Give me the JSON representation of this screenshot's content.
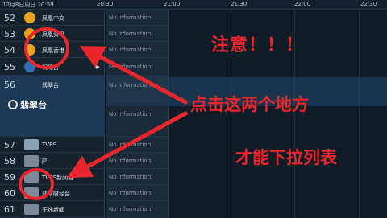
{
  "header": {
    "date": "12月8日周日 20:59",
    "ticks": [
      "20:30",
      "21:00",
      "21:30",
      "22:00",
      "22:30"
    ]
  },
  "channels": [
    {
      "num": "52",
      "name": "凤凰中文",
      "logo_color": "#e9a21c"
    },
    {
      "num": "53",
      "name": "凤凰资讯",
      "logo_color": "#e9a21c"
    },
    {
      "num": "54",
      "name": "凤凰香港",
      "logo_color": "#e9a21c"
    },
    {
      "num": "55",
      "name": "明珠台",
      "logo_color": "#2e6fb7"
    },
    {
      "num": "56",
      "name": "翡翠台",
      "logo_color": "#ffffff"
    },
    {
      "num": "57",
      "name": "TVBS",
      "logo_color": "#8aa0b5"
    },
    {
      "num": "58",
      "name": "J2",
      "logo_color": "#7a8a9a"
    },
    {
      "num": "59",
      "name": "TVBS新闻台",
      "logo_color": "#7a8a9a"
    },
    {
      "num": "60",
      "name": "翡翠财经台",
      "logo_color": "#7a8a9a"
    },
    {
      "num": "61",
      "name": "无线新闻",
      "logo_color": "#7a8a9a"
    }
  ],
  "tvb_logo_text": "翡翠台",
  "no_info": "No information",
  "annotations": {
    "line1": "注意！！！",
    "line2": "点击这两个地方",
    "line3": "才能下拉列表",
    "color": "#e8262b"
  }
}
